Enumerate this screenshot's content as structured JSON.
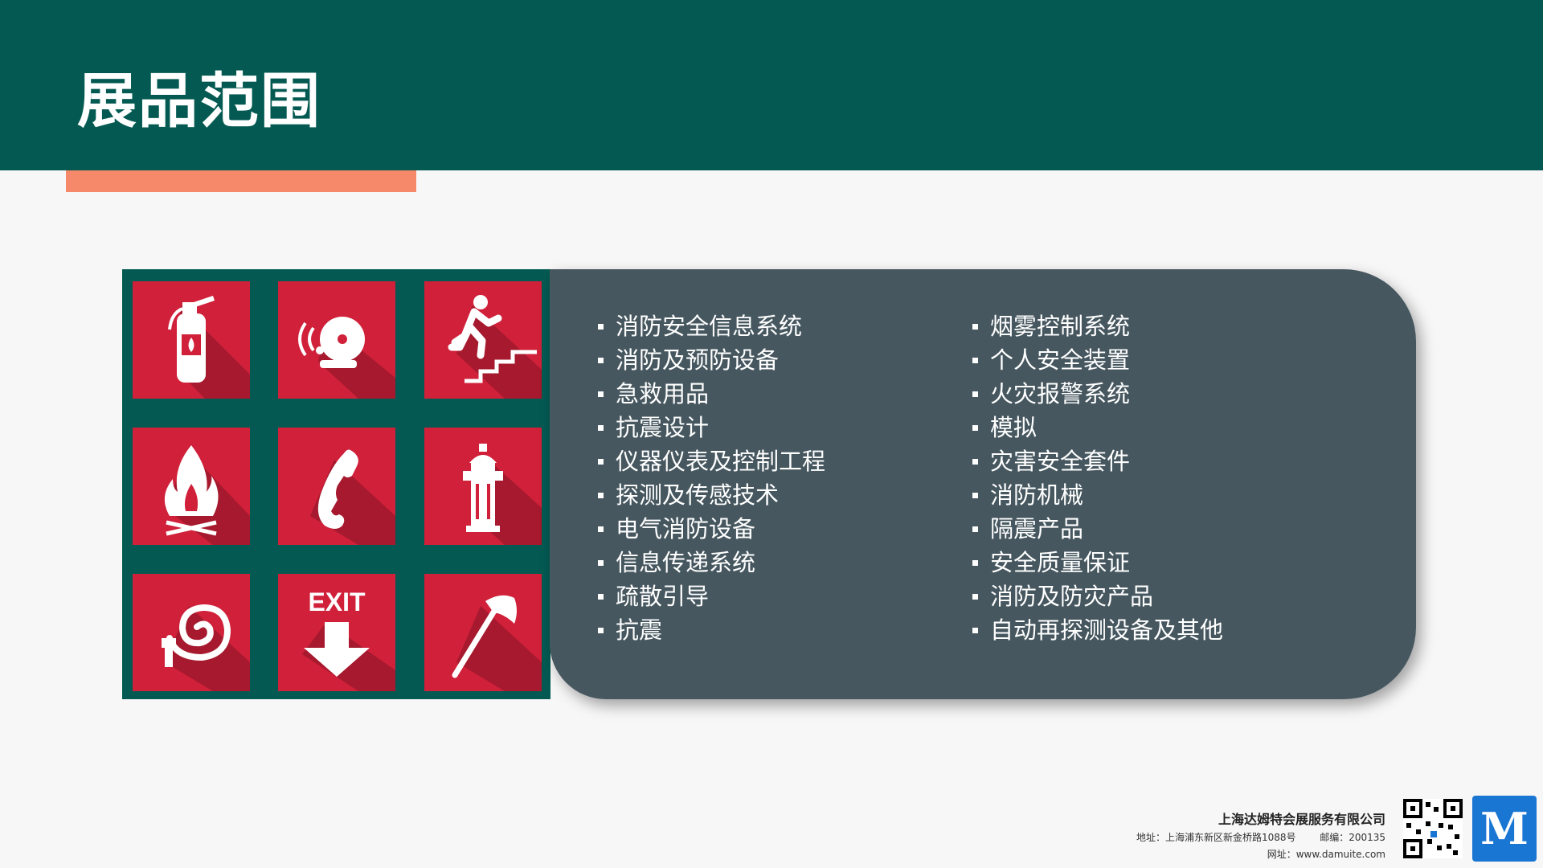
{
  "slide": {
    "title": "展品范围",
    "colors": {
      "header": "#045a52",
      "accent": "#f5896a",
      "tile": "#d0203a",
      "panel": "#46575f"
    }
  },
  "icons": [
    "fire-extinguisher-icon",
    "alarm-bell-icon",
    "emergency-exit-stairs-icon",
    "fire-icon",
    "phone-icon",
    "fire-hydrant-icon",
    "fire-hose-icon",
    "exit-arrow-icon",
    "fire-axe-icon"
  ],
  "exit_sign_text": "EXIT",
  "list": {
    "left": [
      "消防安全信息系统",
      "消防及预防设备",
      "急救用品",
      "抗震设计",
      "仪器仪表及控制工程",
      "探测及传感技术",
      "电气消防设备",
      "信息传递系统",
      "疏散引导",
      "抗震"
    ],
    "right": [
      "烟雾控制系统",
      "个人安全装置",
      "火灾报警系统",
      "模拟",
      "灾害安全套件",
      "消防机械",
      "隔震产品",
      "安全质量保证",
      "消防及防灾产品",
      "自动再探测设备及其他"
    ]
  },
  "footer": {
    "company": "上海达姆特会展服务有限公司",
    "address": "地址：上海浦东新区新金桥路1088号",
    "postcode": "邮编：200135",
    "website": "网址：www.damuite.com",
    "logo_text": "M"
  }
}
